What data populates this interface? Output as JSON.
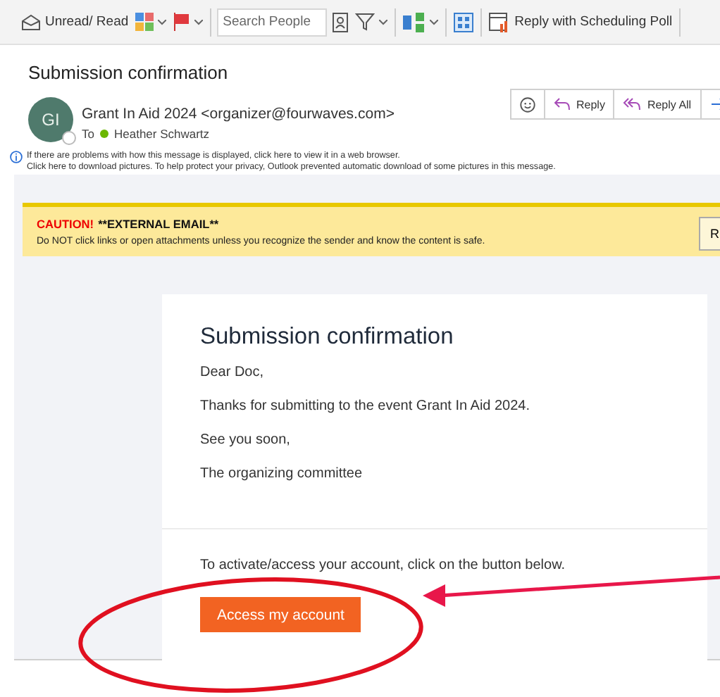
{
  "toolbar": {
    "read_button": {
      "label": "Unread/ Read"
    },
    "search": {
      "placeholder": "Search People"
    },
    "poll_button": {
      "label": "Reply with Scheduling Poll"
    }
  },
  "message": {
    "subject": "Submission confirmation",
    "sender": {
      "initials": "GI",
      "line": "Grant In Aid 2024 <organizer@fourwaves.com>"
    },
    "to_label": "To",
    "recipient": "Heather Schwartz",
    "actions": [
      {
        "kind": "emoji"
      },
      {
        "kind": "reply",
        "label": "Reply"
      },
      {
        "kind": "reply_all",
        "label": "Reply All"
      },
      {
        "kind": "forward"
      }
    ],
    "info_lines": [
      "If there are problems with how this message is displayed, click here to view it in a web browser.",
      "Click here to download pictures. To help protect your privacy, Outlook prevented automatic download of some pictures in this message."
    ]
  },
  "caution": {
    "title": "CAUTION!",
    "tag": "**EXTERNAL EMAIL**",
    "text": "Do NOT click links or open attachments unless you recognize the sender and know the content is safe.",
    "button": "R"
  },
  "email": {
    "heading": "Submission confirmation",
    "paragraphs": [
      "Dear Doc,",
      "Thanks for submitting to the event Grant In Aid 2024.",
      "See you soon,",
      "The organizing committee"
    ],
    "cta_text": "To activate/access your account, click on the button below.",
    "button": "Access my account"
  }
}
